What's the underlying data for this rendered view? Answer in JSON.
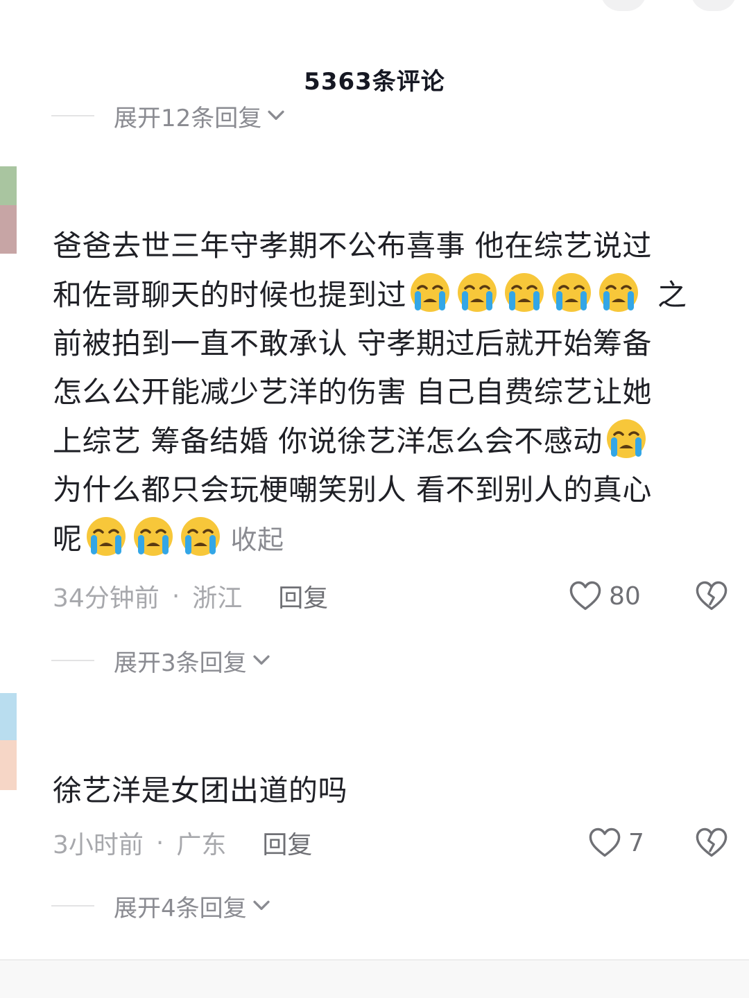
{
  "top": {
    "cut_text": "",
    "cut_text_highlight": ""
  },
  "header": {
    "comment_count_title": "5363条评论"
  },
  "expanders": {
    "first": "展开12条回复",
    "second": "展开3条回复",
    "third": "展开4条回复"
  },
  "comments": [
    {
      "lines": [
        "爸爸去世三年守孝期不公布喜事  他在综艺说过",
        "和佐哥聊天的时候也提到过",
        "之",
        "前被拍到一直不敢承认  守孝期过后就开始筹备",
        "怎么公开能减少艺洋的伤害 自己自费综艺让她",
        "上综艺  筹备结婚  你说徐艺洋怎么会不感动",
        "为什么都只会玩梗嘲笑别人 看不到别人的真心",
        "呢"
      ],
      "collapse_label": "收起",
      "time": "34分钟前",
      "location": "浙江",
      "reply_label": "回复",
      "likes": "80",
      "emoji": "loudly-crying-face"
    },
    {
      "lines": [
        "徐艺洋是女团出道的吗"
      ],
      "time": "3小时前",
      "location": "广东",
      "reply_label": "回复",
      "likes": "7"
    }
  ],
  "separator": "·",
  "colors": {
    "text_primary": "#1f2026",
    "text_secondary": "#8a8b91",
    "meta": "#a7a8ac",
    "emoji_face": "#f7c73a",
    "emoji_tear": "#33a6e6"
  }
}
